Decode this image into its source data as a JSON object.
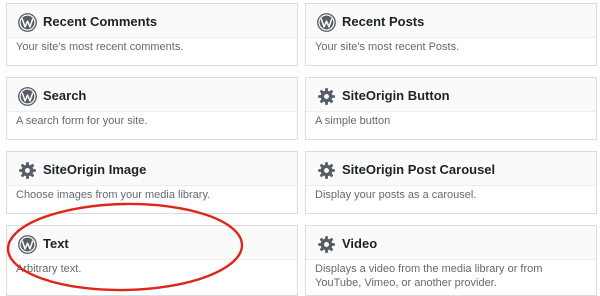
{
  "widgets": [
    {
      "title": "Recent Comments",
      "description": "Your site's most recent comments.",
      "icon": "wordpress-icon"
    },
    {
      "title": "Recent Posts",
      "description": "Your site's most recent Posts.",
      "icon": "wordpress-icon"
    },
    {
      "title": "Search",
      "description": "A search form for your site.",
      "icon": "wordpress-icon"
    },
    {
      "title": "SiteOrigin Button",
      "description": "A simple button",
      "icon": "gear-icon"
    },
    {
      "title": "SiteOrigin Image",
      "description": "Choose images from your media library.",
      "icon": "gear-icon"
    },
    {
      "title": "SiteOrigin Post Carousel",
      "description": "Display your posts as a carousel.",
      "icon": "gear-icon"
    },
    {
      "title": "Text",
      "description": "Arbitrary text.",
      "icon": "wordpress-icon"
    },
    {
      "title": "Video",
      "description": "Displays a video from the media library or from YouTube, Vimeo, or another provider.",
      "icon": "gear-icon"
    }
  ],
  "highlight_color": "#e0251b"
}
